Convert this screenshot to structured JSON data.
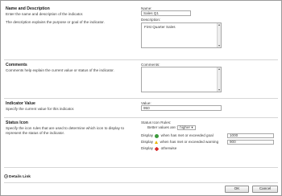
{
  "name_section": {
    "title": "Name and Description",
    "desc1": "Enter the name and description of the indicator.",
    "desc2": "The description explains the purpose or goal of the indicator.",
    "name_label": "Name:",
    "name_value": "Sales Q1",
    "description_label": "Description:",
    "description_value": "First Quarter Sales"
  },
  "comments_section": {
    "title": "Comments",
    "desc": "Comments help explain the current value or status of the indicator.",
    "comments_label": "Comments:",
    "comments_value": ""
  },
  "value_section": {
    "title": "Indicator Value",
    "desc": "Specify the current value for this indicator.",
    "value_label": "Value:",
    "value": "950"
  },
  "status_section": {
    "title": "Status Icon",
    "desc": "Specify the icon rules that are used to determine which icon to display to represent the status of the indicator.",
    "rules_label": "Status Icon Rules:",
    "better_label": "Better values are:",
    "better_value": "higher",
    "rule_goal_prefix": "Display",
    "rule_goal_text": "when has met or exceeded goal",
    "rule_goal_value": "1000",
    "rule_warning_prefix": "Display",
    "rule_warning_text": "when has met or exceeded warning",
    "rule_warning_value": "900",
    "rule_otherwise_prefix": "Display",
    "rule_otherwise_text": "otherwise",
    "colors": {
      "goal": "#3c9a3c",
      "warning": "#e9b600",
      "otherwise": "#d62b2b"
    }
  },
  "details_link": "Details Link",
  "buttons": {
    "ok": "OK",
    "cancel": "Cancel"
  }
}
